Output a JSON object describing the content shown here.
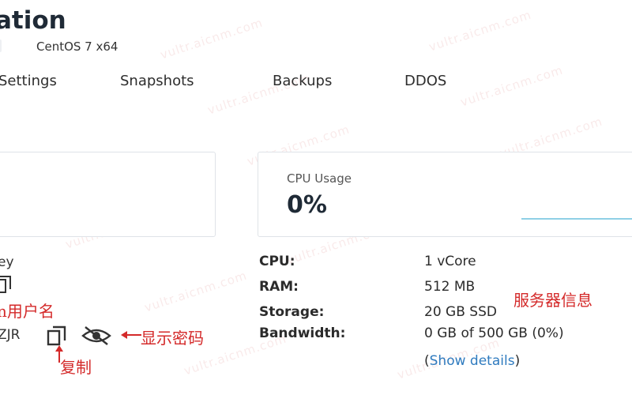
{
  "header": {
    "title": "ation",
    "os": "CentOS 7 x64"
  },
  "tabs": [
    {
      "label": "Settings"
    },
    {
      "label": "Snapshots"
    },
    {
      "label": "Backups"
    },
    {
      "label": "DDOS"
    }
  ],
  "cpu_card": {
    "label": "CPU Usage",
    "value": "0%"
  },
  "credentials": {
    "key_fragment": "ey",
    "password_fragment": "ZJR"
  },
  "annotations": {
    "username": "n用户名",
    "show_password": "显示密码",
    "copy": "复制",
    "server_info": "服务器信息"
  },
  "specs": [
    {
      "label": "CPU:",
      "value": "1 vCore"
    },
    {
      "label": "RAM:",
      "value": "512 MB"
    },
    {
      "label": "Storage:",
      "value": "20 GB SSD"
    },
    {
      "label": "Bandwidth:",
      "value": "0 GB of 500 GB (0%)"
    }
  ],
  "show_details": {
    "open": "(",
    "link": "Show details",
    "close": ")"
  },
  "watermark": "vultr.aicnm.com",
  "colors": {
    "annotation": "#d42a2a",
    "link": "#2f7bbf",
    "cpu_line": "#8fd0e6"
  }
}
